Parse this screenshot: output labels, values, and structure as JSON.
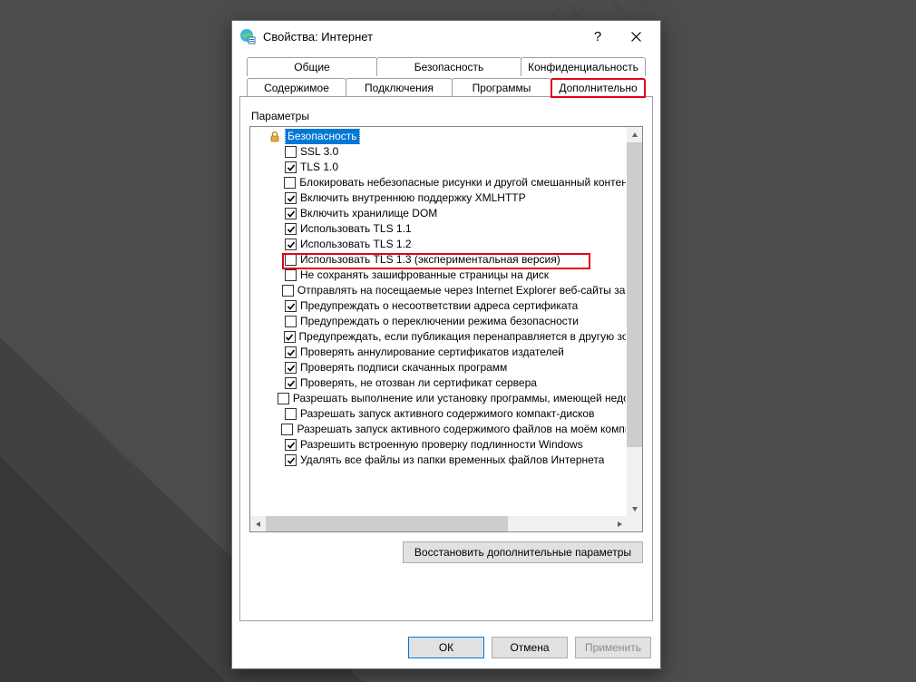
{
  "window": {
    "title": "Свойства: Интернет"
  },
  "tabs_row1": [
    {
      "label": "Общие"
    },
    {
      "label": "Безопасность"
    },
    {
      "label": "Конфиденциальность"
    }
  ],
  "tabs_row2": [
    {
      "label": "Содержимое"
    },
    {
      "label": "Подключения"
    },
    {
      "label": "Программы"
    },
    {
      "label": "Дополнительно",
      "selected": true
    }
  ],
  "section_label": "Параметры",
  "tree": {
    "category": "Безопасность",
    "items": [
      {
        "checked": false,
        "label": "SSL 3.0"
      },
      {
        "checked": true,
        "label": "TLS 1.0"
      },
      {
        "checked": false,
        "label": "Блокировать небезопасные рисунки и другой смешанный контент"
      },
      {
        "checked": true,
        "label": "Включить внутреннюю поддержку XMLHTTP"
      },
      {
        "checked": true,
        "label": "Включить хранилище DOM"
      },
      {
        "checked": true,
        "label": "Использовать TLS 1.1"
      },
      {
        "checked": true,
        "label": "Использовать TLS 1.2"
      },
      {
        "checked": false,
        "label": "Использовать TLS 1.3 (экспериментальная версия)",
        "highlight": true
      },
      {
        "checked": false,
        "label": "Не сохранять зашифрованные страницы на диск"
      },
      {
        "checked": false,
        "label": "Отправлять на посещаемые через Internet Explorer веб-сайты запросы"
      },
      {
        "checked": true,
        "label": "Предупреждать о несоответствии адреса сертификата"
      },
      {
        "checked": false,
        "label": "Предупреждать о переключении режима безопасности"
      },
      {
        "checked": true,
        "label": "Предупреждать, если публикация перенаправляется в другую зону"
      },
      {
        "checked": true,
        "label": "Проверять аннулирование сертификатов издателей"
      },
      {
        "checked": true,
        "label": "Проверять подписи скачанных программ"
      },
      {
        "checked": true,
        "label": "Проверять, не отозван ли сертификат сервера"
      },
      {
        "checked": false,
        "label": "Разрешать выполнение или установку программы, имеющей недопустимую подпись"
      },
      {
        "checked": false,
        "label": "Разрешать запуск активного содержимого компакт-дисков"
      },
      {
        "checked": false,
        "label": "Разрешать запуск активного содержимого файлов на моём компьютере"
      },
      {
        "checked": true,
        "label": "Разрешить встроенную проверку подлинности Windows"
      },
      {
        "checked": true,
        "label": "Удалять все файлы из папки временных файлов Интернета"
      }
    ]
  },
  "buttons": {
    "restore": "Восстановить дополнительные параметры",
    "ok": "ОК",
    "cancel": "Отмена",
    "apply": "Применить"
  },
  "watermark": "spy-soft.net"
}
